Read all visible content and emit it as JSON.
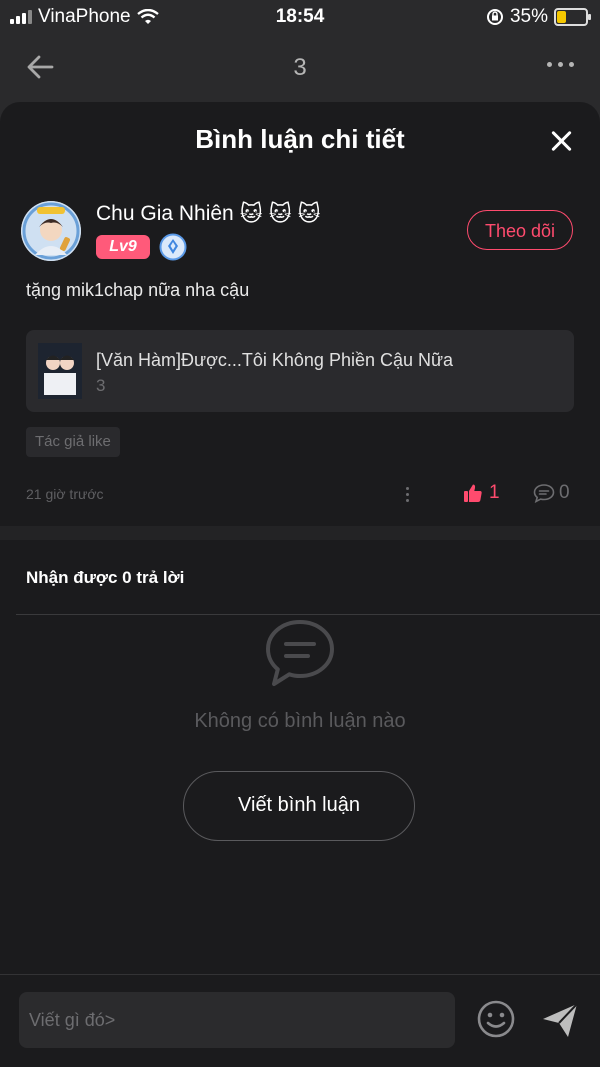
{
  "status_bar": {
    "carrier": "VinaPhone",
    "time": "18:54",
    "battery": "35%",
    "battery_level": 0.35
  },
  "navbar": {
    "title": "3"
  },
  "sheet": {
    "title": "Bình luận chi tiết"
  },
  "user": {
    "name": "Chu Gia Nhiên",
    "emojis": [
      "🐱",
      "🐱",
      "🐱"
    ],
    "level": "Lv9",
    "follow_label": "Theo dõi"
  },
  "comment": {
    "text": "tặng mik1chap nữa nha cậu"
  },
  "book": {
    "title": "[Văn Hàm]Được...Tôi Không Phiền Cậu Nữa",
    "chapter": "3"
  },
  "tag": "Tác giả like",
  "meta": {
    "time_ago": "21 giờ trước",
    "likes": "1",
    "replies": "0"
  },
  "replies": {
    "header": "Nhận được 0 trả lời",
    "empty_text": "Không có bình luận nào",
    "write_button": "Viết bình luận"
  },
  "composer": {
    "placeholder": "Viết gì đó>"
  },
  "colors": {
    "accent": "#ff4b6e",
    "sheet_bg": "#1b1b1d",
    "level_badge": "#ff5a7a"
  }
}
